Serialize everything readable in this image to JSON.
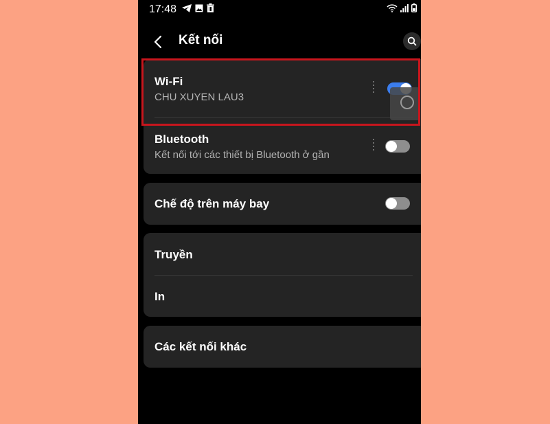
{
  "status_bar": {
    "time": "17:48",
    "left_icons": [
      "telegram-icon",
      "image-icon",
      "trash-icon"
    ],
    "right_icons": [
      "wifi-icon",
      "signal-icon",
      "battery-icon"
    ]
  },
  "header": {
    "title": "Kết nối",
    "back_icon": "chevron-left-icon",
    "search_icon": "search-icon"
  },
  "settings": {
    "wifi": {
      "title": "Wi-Fi",
      "subtitle": "CHU XUYEN LAU3",
      "enabled": true
    },
    "bluetooth": {
      "title": "Bluetooth",
      "subtitle": "Kết nối tới các thiết bị Bluetooth ở gần",
      "enabled": false
    },
    "airplane": {
      "title": "Chế độ trên máy bay",
      "enabled": false
    },
    "cast": {
      "title": "Truyền"
    },
    "print": {
      "title": "In"
    },
    "more": {
      "title": "Các kết nối khác"
    }
  },
  "colors": {
    "background": "#FCA283",
    "screen": "#000000",
    "card": "#242424",
    "toggle_on": "#3B7DED",
    "toggle_off": "#8E8E8E",
    "highlight": "#C8161D"
  }
}
